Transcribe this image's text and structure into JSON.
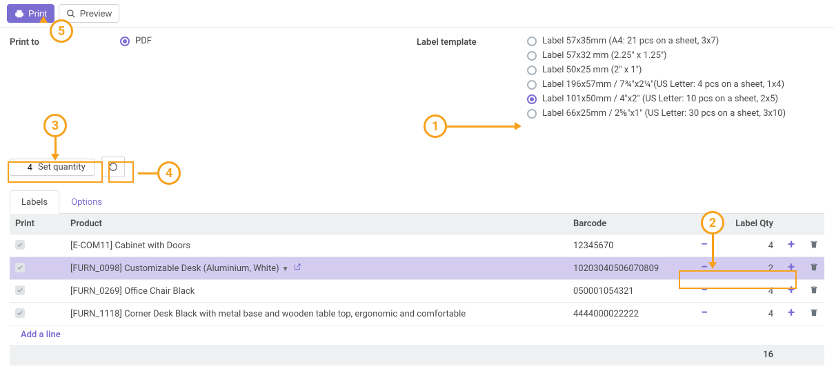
{
  "toolbar": {
    "print_label": "Print",
    "preview_label": "Preview"
  },
  "form": {
    "print_to_label": "Print to",
    "print_to_value": "PDF",
    "label_template_label": "Label template",
    "template_options": [
      "Label 57x35mm (A4: 21 pcs on a sheet, 3x7)",
      "Label 57x32 mm (2.25\" x 1.25\")",
      "Label 50x25 mm (2\" x 1\")",
      "Label 196x57mm / 7¾\"x2¼\"(US Letter: 4 pcs on a sheet, 1x4)",
      "Label 101x50mm / 4\"x2\" (US Letter: 10 pcs on a sheet, 2x5)",
      "Label 66x25mm / 2⅝\"x1\" (US Letter: 30 pcs on a sheet, 3x10)"
    ],
    "template_selected_index": 4,
    "qty_value": "4",
    "set_qty_label": "Set quantity"
  },
  "tabs": {
    "labels": "Labels",
    "options": "Options",
    "active": "labels"
  },
  "table": {
    "headers": {
      "print": "Print",
      "product": "Product",
      "barcode": "Barcode",
      "qty": "Label Qty"
    },
    "rows": [
      {
        "checked": true,
        "product": "[E-COM11] Cabinet with Doors",
        "barcode": "12345670",
        "qty": 4,
        "selected": false
      },
      {
        "checked": true,
        "product": "[FURN_0098] Customizable Desk (Aluminium, White)",
        "barcode": "10203040506070809",
        "qty": 2,
        "selected": true
      },
      {
        "checked": true,
        "product": "[FURN_0269] Office Chair Black",
        "barcode": "050001054321",
        "qty": 4,
        "selected": false
      },
      {
        "checked": true,
        "product": "[FURN_1118] Corner Desk Black with metal base and wooden table top, ergonomic and comfortable",
        "barcode": "4444000022222",
        "qty": 4,
        "selected": false
      }
    ],
    "add_line_label": "Add a line",
    "total_qty": 16
  },
  "callouts": {
    "c1": "1",
    "c2": "2",
    "c3": "3",
    "c4": "4",
    "c5": "5"
  }
}
